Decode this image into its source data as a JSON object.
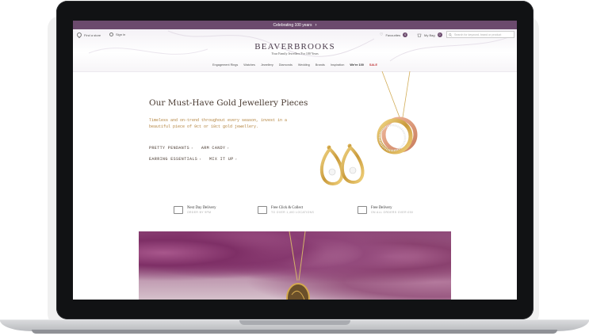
{
  "announcement": {
    "text": "Celebrating 100 years",
    "chevron": "›"
  },
  "header": {
    "find_store": "Find a store",
    "sign_in": "Sign in",
    "favourites": "Favourites",
    "favourites_count": "0",
    "bag": "My Bag",
    "bag_count": "0",
    "search_placeholder": "Search for keyword, brand or product",
    "logo": "BEAVERBROOKS",
    "tagline": "Your Family Jewellers For 100 Years"
  },
  "nav": {
    "items": [
      "Engagement Rings",
      "Watches",
      "Jewellery",
      "Diamonds",
      "Wedding",
      "Brands",
      "Inspiration",
      "We're 100",
      "SALE"
    ]
  },
  "hero": {
    "title": "Our Must-Have Gold Jewellery Pieces",
    "subtitle": "Timeless and on-trend throughout every season, invest in a beautiful piece of 9ct or 18ct gold jewellery.",
    "links": [
      "PRETTY PENDANTS",
      "ARM CANDY",
      "EARRING ESSENTIALS",
      "MIX IT UP"
    ],
    "link_arrow": "›"
  },
  "usps": [
    {
      "title": "Next Day Delivery",
      "subtitle": "ORDER BY 9PM",
      "icon": "truck-icon"
    },
    {
      "title": "Free Click & Collect",
      "subtitle": "TO OVER 1,400 LOCATIONS",
      "icon": "box-icon"
    },
    {
      "title": "Free Delivery",
      "subtitle": "ON ALL ORDERS OVER £50",
      "icon": "van-icon"
    }
  ],
  "colors": {
    "brand": "#6b4a6d",
    "sale": "#c0393b",
    "gold_text": "#b3833d",
    "heading": "#4a3b32"
  }
}
